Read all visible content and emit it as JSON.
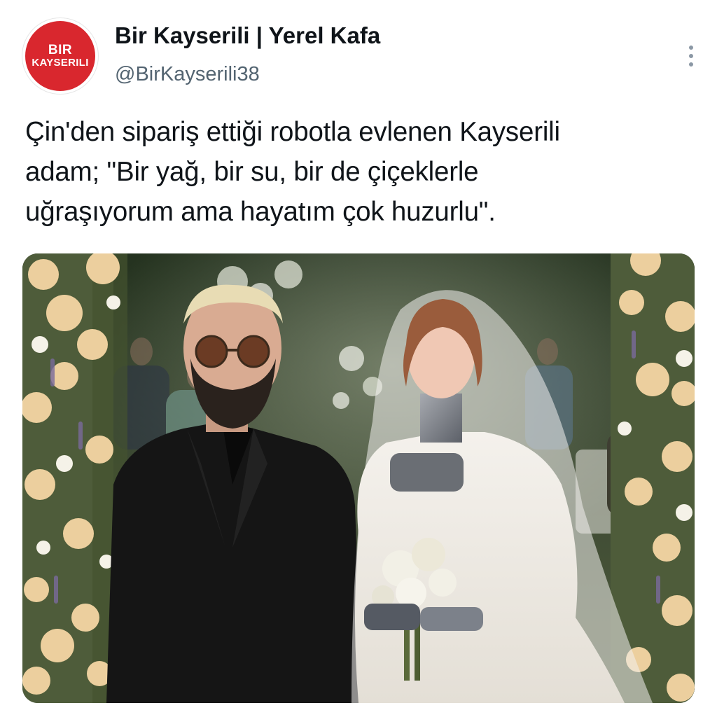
{
  "author": {
    "avatar_line1": "BIR",
    "avatar_line2": "KAYSERILI",
    "display_name": "Bir Kayserili | Yerel Kafa",
    "handle": "@BirKayserili38"
  },
  "post": {
    "text_lines": [
      "Çin'den sipariş ettiği robotla evlenen Kayserili",
      "adam; \"Bir yağ, bir su, bir de çiçeklerle",
      "uğraşıyorum ama hayatım çok huzurlu\"."
    ]
  },
  "icons": {
    "more": "more-vertical-icon"
  },
  "colors": {
    "avatar_red": "#d9272e",
    "handle_gray": "#536471",
    "text": "#0f1419"
  }
}
